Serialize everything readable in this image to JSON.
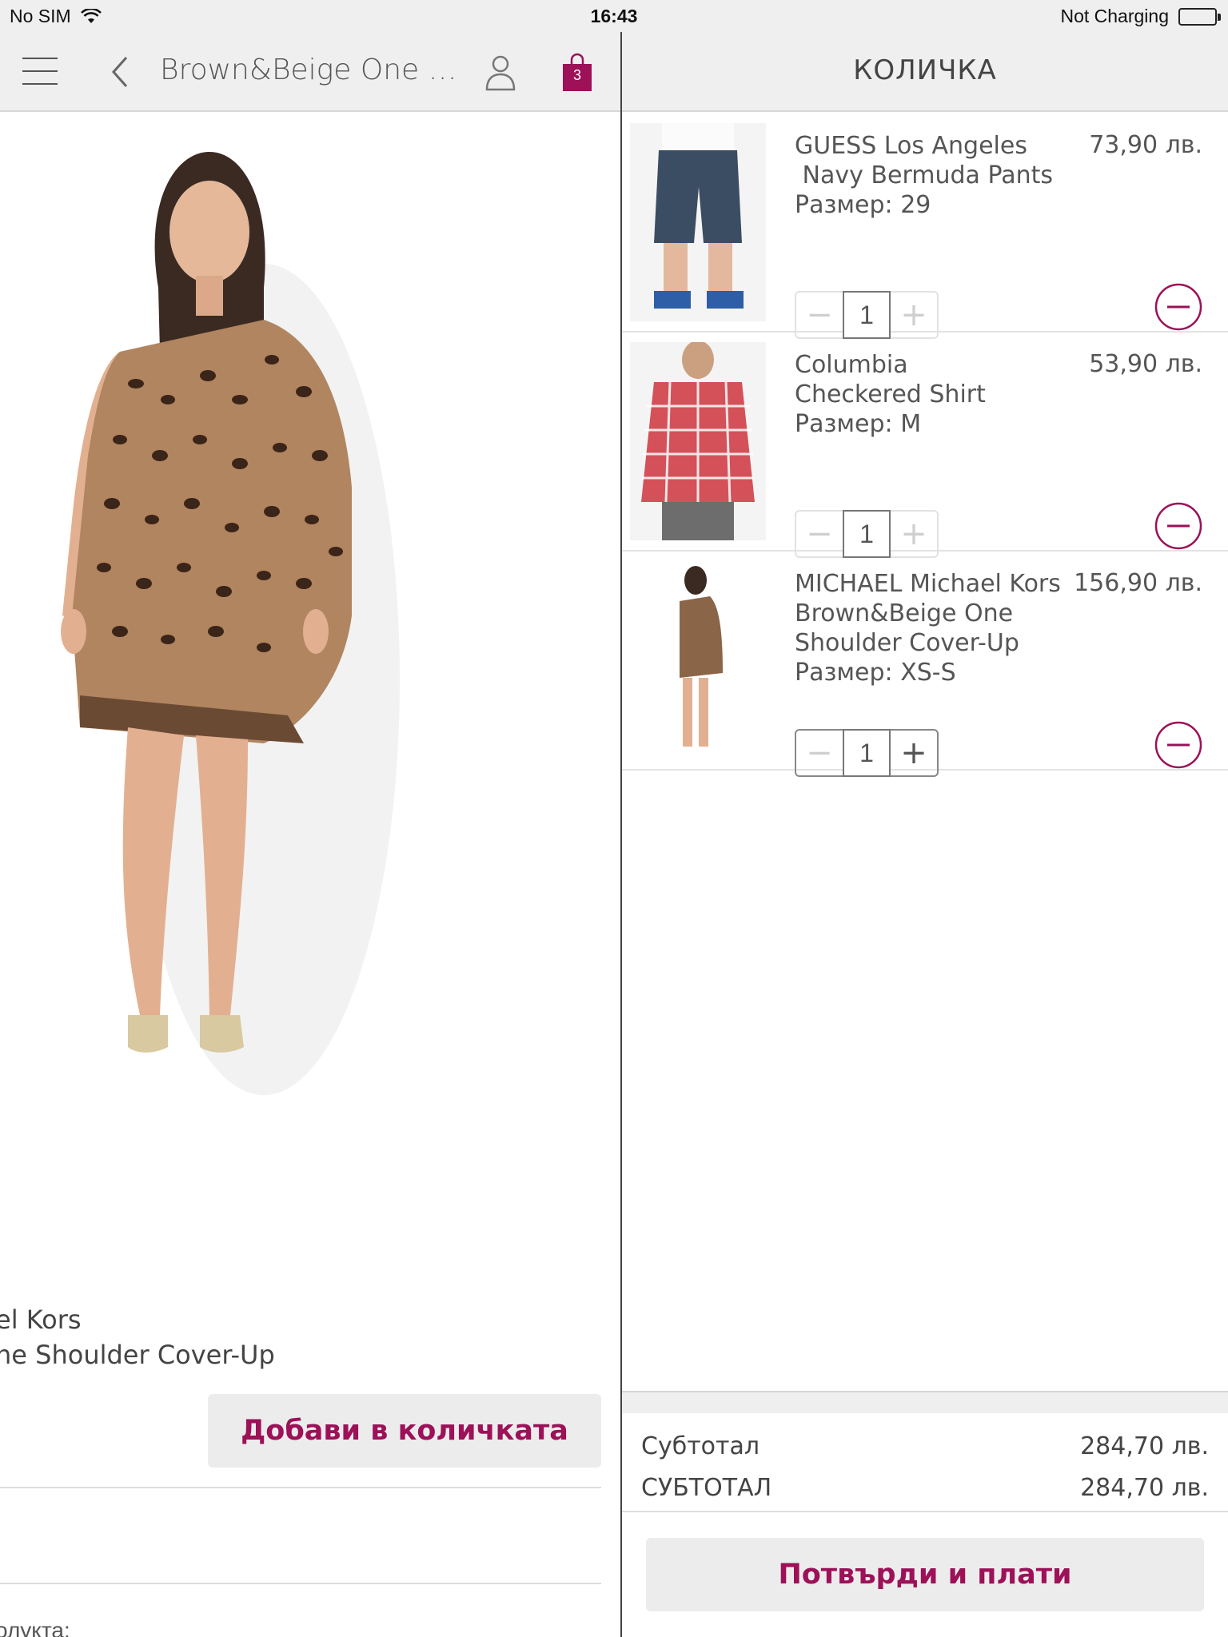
{
  "status_bar": {
    "carrier": "No SIM",
    "time": "16:43",
    "charging": "Not Charging",
    "icons": [
      "wifi-icon",
      "battery-icon"
    ]
  },
  "product_view": {
    "nav_title": "Brown&Beige One Sho...",
    "cart_count": "3",
    "icons": [
      "menu-icon",
      "back-icon",
      "user-icon",
      "bag-icon"
    ],
    "brand_partial": "el Kors",
    "name_partial": "ne Shoulder Cover-Up",
    "add_to_cart_label": "Добави в количката",
    "section_label_partial": "олукта:"
  },
  "cart": {
    "title": "КОЛИЧКА",
    "items": [
      {
        "name_line1": "GUESS Los Angeles",
        "name_line2": " Navy Bermuda Pants",
        "name_line3": "",
        "size": "Размер: 29",
        "price": "73,90 лв.",
        "quantity": "1",
        "minus": "−",
        "plus": "+"
      },
      {
        "name_line1": "Columbia",
        "name_line2": "Checkered Shirt",
        "name_line3": "",
        "size": "Размер: M",
        "price": "53,90 лв.",
        "quantity": "1",
        "minus": "−",
        "plus": "+"
      },
      {
        "name_line1": "MICHAEL Michael Kors",
        "name_line2": "Brown&Beige One",
        "name_line3": "Shoulder Cover-Up",
        "size": "Размер: XS-S",
        "price": "156,90 лв.",
        "quantity": "1",
        "minus": "−",
        "plus": "+"
      }
    ],
    "subtotal_label": "Субтотал",
    "subtotal_value": "284,70 лв.",
    "total_label": "СУБТОТАЛ",
    "total_value": "284,70 лв.",
    "confirm_label": "Потвърди и плати"
  },
  "colors": {
    "accent": "#9c1158",
    "nav_bg": "#efefef"
  }
}
